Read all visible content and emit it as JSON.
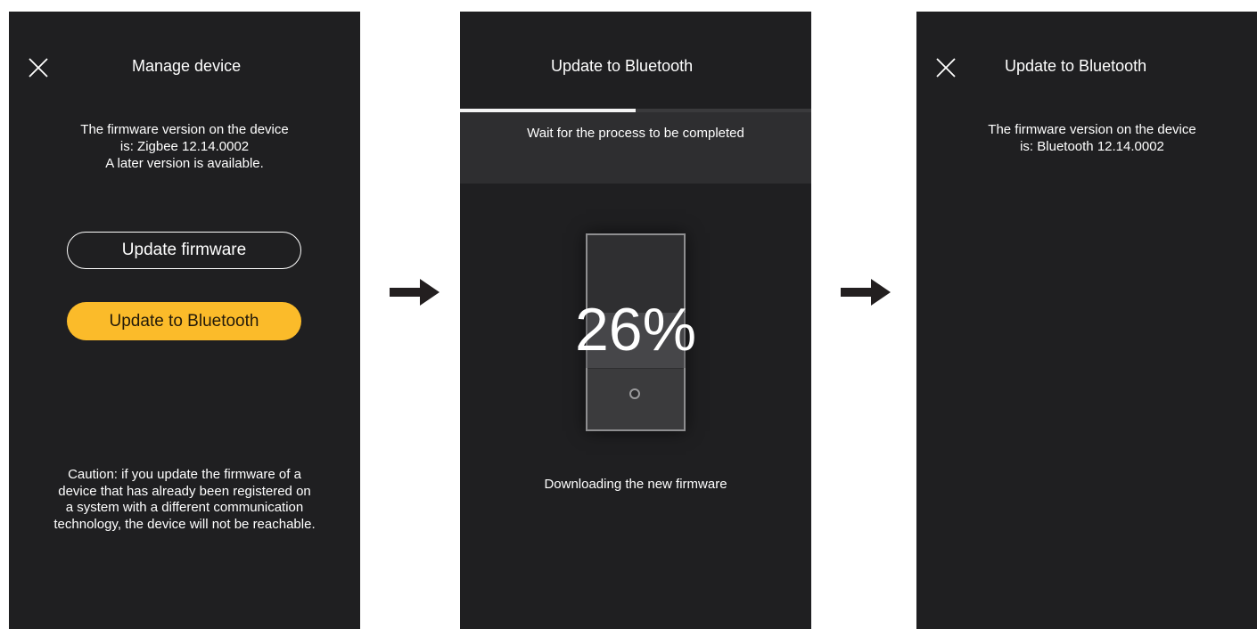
{
  "screen1": {
    "title": "Manage device",
    "info_lines": [
      "The firmware version on the device",
      "is: Zigbee 12.14.0002",
      "A later version is available."
    ],
    "update_firmware_label": "Update firmware",
    "update_bluetooth_label": "Update to Bluetooth",
    "caution_lines": [
      "Caution: if you update the firmware of a",
      "device that has already been registered on",
      "a system with a different communication",
      "technology, the device will not be reachable."
    ]
  },
  "screen2": {
    "title": "Update to Bluetooth",
    "wait_text": "Wait for the process to be completed",
    "percent_text": "26%",
    "progress_fraction": 0.5,
    "download_text": "Downloading the new firmware"
  },
  "screen3": {
    "title": "Update to Bluetooth",
    "info_lines": [
      "The firmware version on the device",
      "is: Bluetooth 12.14.0002"
    ]
  },
  "colors": {
    "screen_bg": "#1f1f21",
    "accent_yellow": "#fbbb2a",
    "arrow": "#231f20"
  },
  "icons": {
    "close": "close-icon",
    "arrow": "right-arrow-icon",
    "led": "led-indicator-icon"
  }
}
